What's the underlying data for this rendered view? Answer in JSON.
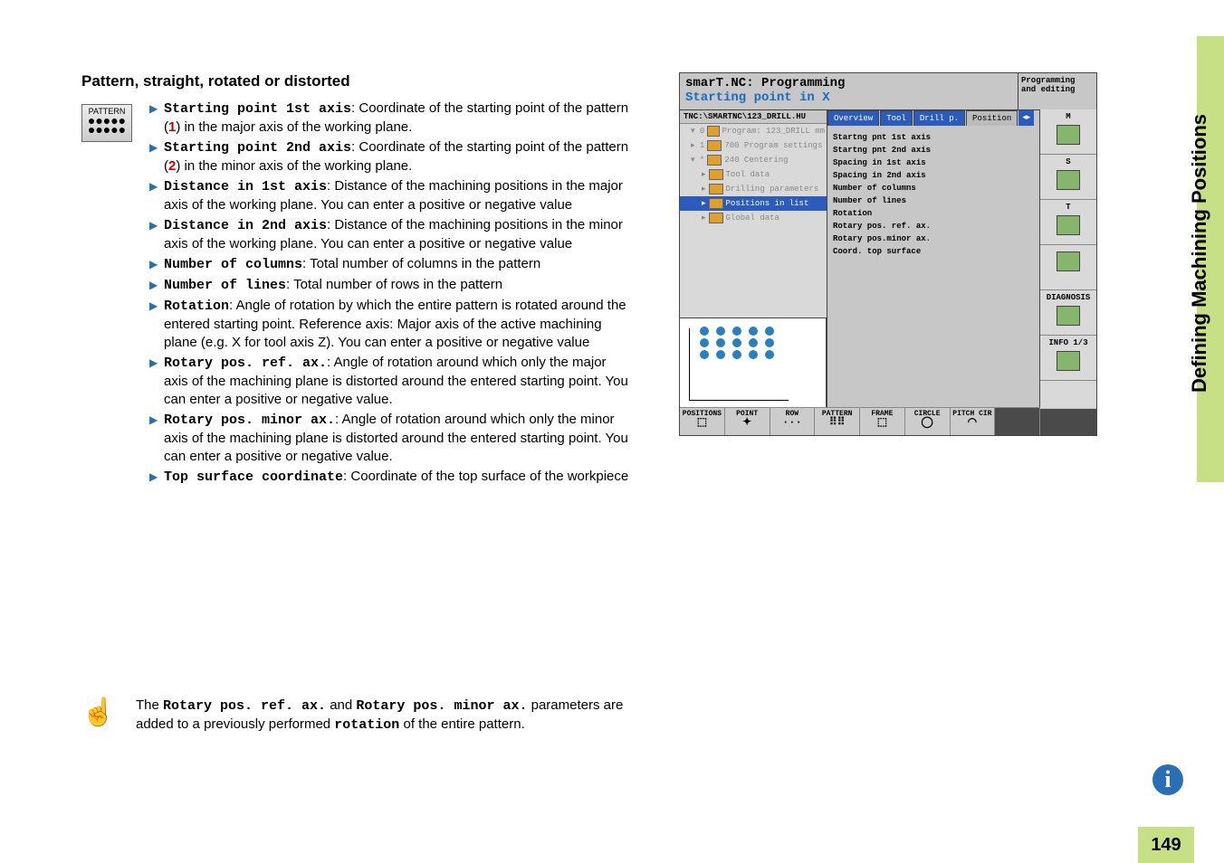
{
  "heading": "Pattern, straight, rotated or distorted",
  "patternButtonLabel": "PATTERN",
  "params": [
    {
      "term": "Starting point 1st axis",
      "rest": ": Coordinate of the starting point of the pattern (",
      "num": "1",
      "after": ") in the major axis of the working plane."
    },
    {
      "term": "Starting point 2nd axis",
      "rest": ": Coordinate of the starting point of the pattern (",
      "num": "2",
      "after": ") in the minor axis of the working plane."
    },
    {
      "term": "Distance in 1st axis",
      "rest": ": Distance of the machining positions in the major axis of the working plane. You can enter a positive or negative value"
    },
    {
      "term": "Distance in 2nd axis",
      "rest": ": Distance of the machining positions in the minor axis of the working plane. You can enter a positive or negative value"
    },
    {
      "term": "Number of columns",
      "rest": ": Total number of columns in the pattern"
    },
    {
      "term": "Number of lines",
      "rest": ": Total number of rows in the pattern"
    },
    {
      "term": "Rotation",
      "rest": ": Angle of rotation by which the entire pattern is rotated around the entered starting point. Reference axis: Major axis of the active machining plane (e.g. X for tool axis Z). You can enter a positive or negative value"
    },
    {
      "term": "Rotary pos. ref. ax.",
      "rest": ": Angle of rotation around which only the major axis of the machining plane is distorted around the entered starting point. You can enter a positive or negative value."
    },
    {
      "term": "Rotary pos. minor ax.",
      "rest": ": Angle of rotation around which only the minor axis of the machining plane is distorted around the entered starting point. You can enter a positive or negative value."
    },
    {
      "term": "Top surface coordinate",
      "rest": ": Coordinate of the top surface of the workpiece"
    }
  ],
  "note": {
    "t1": "The ",
    "m1": "Rotary pos. ref. ax.",
    "t2": " and ",
    "m2": "Rotary pos. minor ax.",
    "t3": " parameters are added to a previously performed ",
    "m3": "rotation",
    "t4": " of the entire pattern."
  },
  "screenshot": {
    "title1": "smarT.NC: Programming",
    "title2": "Starting point in X",
    "headRight": "Programming and editing",
    "path": "TNC:\\SMARTNC\\123_DRILL.HU",
    "tree": {
      "i0": "Program: 123_DRILL mm",
      "i1": "700 Program settings",
      "i2": "240 Centering",
      "i3": "Tool data",
      "i4": "Drilling parameters",
      "i5": "Positions in list",
      "i6": "Global data"
    },
    "tabs": [
      "Overview",
      "Tool",
      "Drill p.",
      "Position"
    ],
    "fields": [
      "Startng pnt 1st axis",
      "Startng pnt 2nd axis",
      "Spacing in 1st axis",
      "Spacing in 2nd axis",
      "Number of columns",
      "Number of lines",
      "Rotation",
      "Rotary pos. ref. ax.",
      "Rotary pos.minor ax.",
      "Coord. top surface"
    ],
    "sidebar": [
      "M",
      "S",
      "T",
      "",
      "DIAGNOSIS",
      "INFO 1/3"
    ],
    "softkeys": [
      "POSITIONS",
      "POINT",
      "ROW",
      "PATTERN",
      "FRAME",
      "CIRCLE",
      "PITCH CIR"
    ]
  },
  "rightLabel": "Defining Machining Positions",
  "pageNum": "149"
}
